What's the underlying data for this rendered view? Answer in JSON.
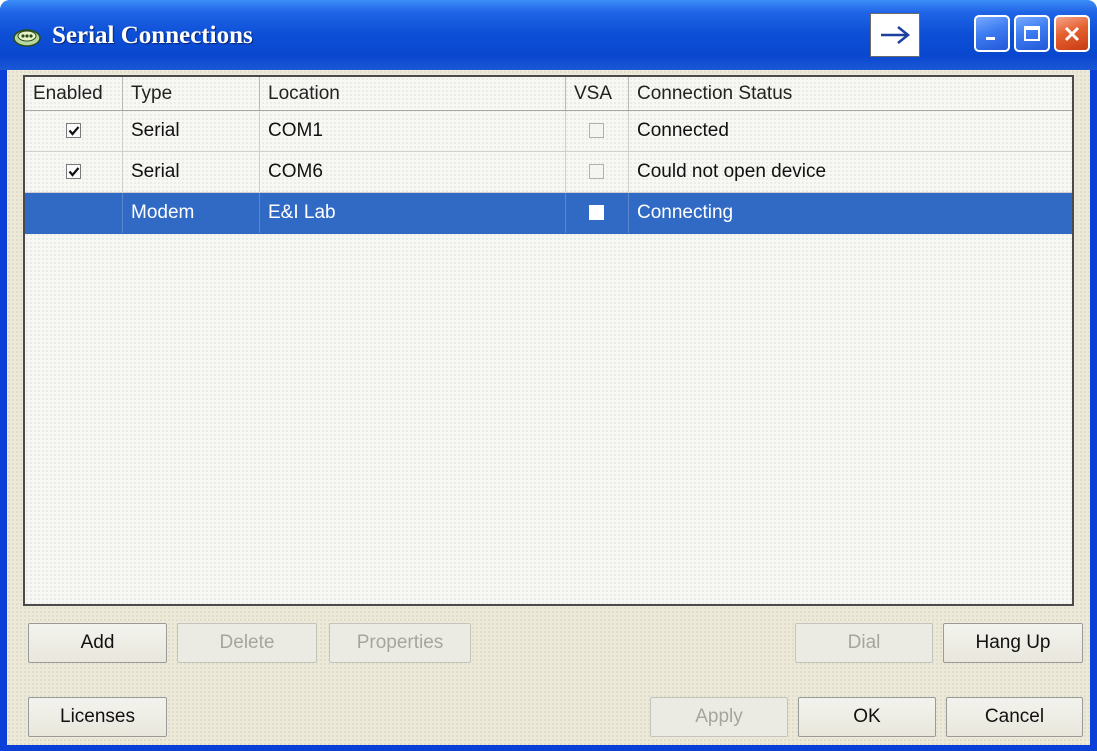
{
  "window": {
    "title": "Serial Connections"
  },
  "icons": {
    "app": "serial-connections-app-icon",
    "dock": "arrow-right-icon",
    "minimize": "minimize-icon",
    "maximize": "maximize-icon",
    "close": "close-icon",
    "check": "check-icon"
  },
  "colors": {
    "titlebar": "#0a47cf",
    "selection": "#316ac5",
    "dialog_bg": "#ece9d8",
    "close_button": "#e5602f"
  },
  "table": {
    "columns": [
      "Enabled",
      "Type",
      "Location",
      "VSA",
      "Connection Status"
    ],
    "rows": [
      {
        "enabled": true,
        "type": "Serial",
        "location": "COM1",
        "vsa": false,
        "status": "Connected",
        "selected": false
      },
      {
        "enabled": true,
        "type": "Serial",
        "location": "COM6",
        "vsa": false,
        "status": "Could not open device",
        "selected": false
      },
      {
        "enabled": false,
        "type": "Modem",
        "location": "E&I Lab",
        "vsa": false,
        "status": "Connecting",
        "selected": true
      }
    ]
  },
  "buttons": {
    "add": "Add",
    "delete": "Delete",
    "properties": "Properties",
    "dial": "Dial",
    "hang_up": "Hang Up",
    "licenses": "Licenses",
    "apply": "Apply",
    "ok": "OK",
    "cancel": "Cancel"
  }
}
